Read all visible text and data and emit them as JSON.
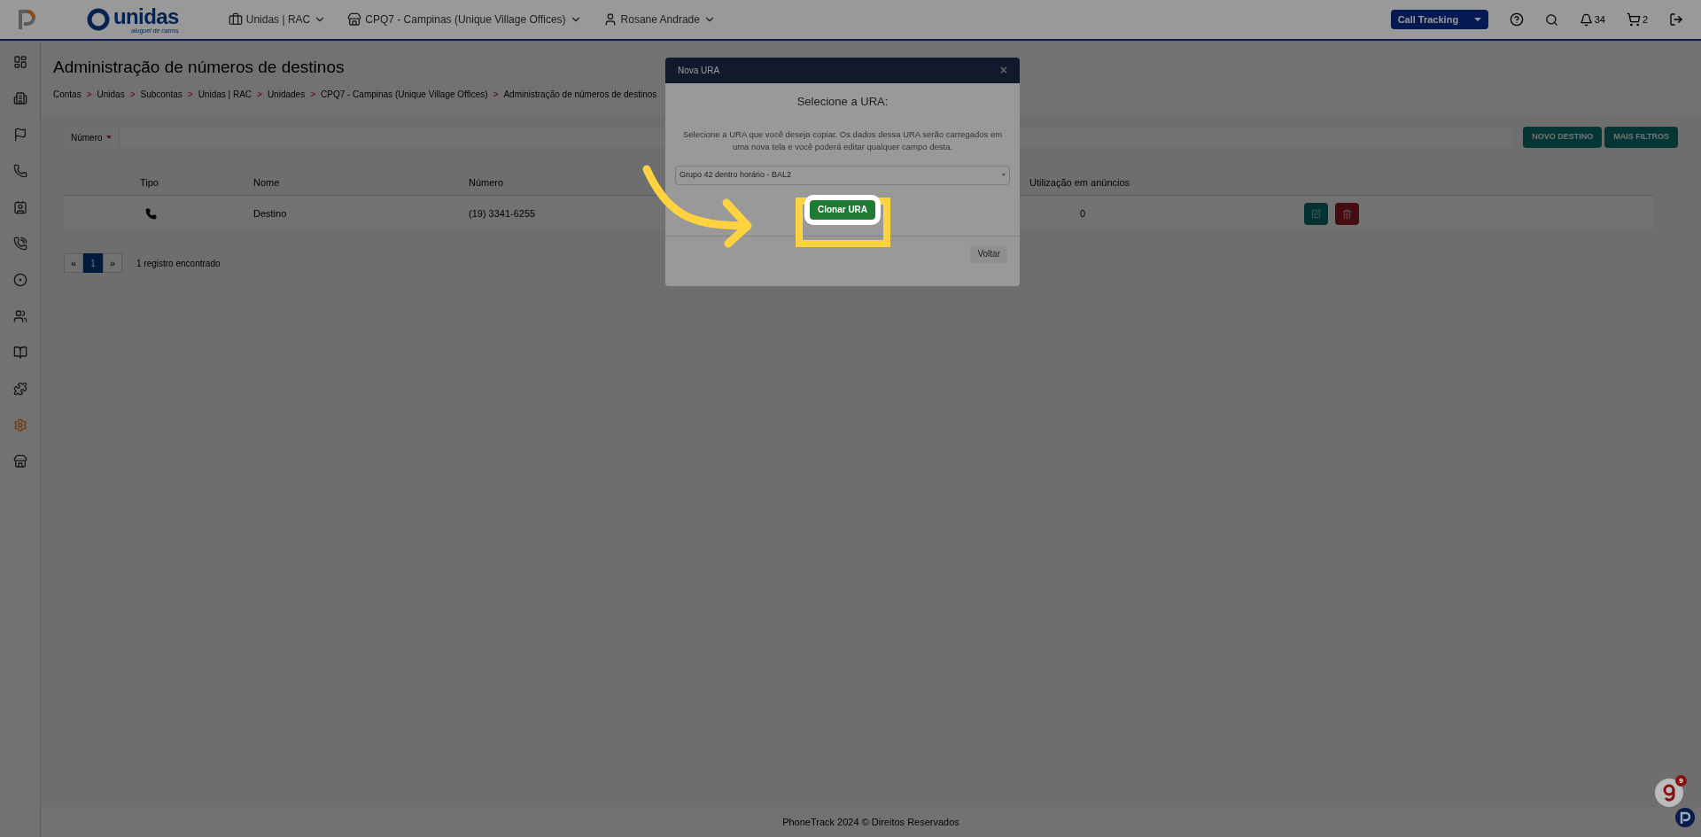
{
  "topbar": {
    "brand": "unidas",
    "tagline": "aluguel de carros",
    "account": "Unidas | RAC",
    "unit": "CPQ7 - Campinas (Unique Village Offices)",
    "user": "Rosane Andrade",
    "product": "Call Tracking",
    "notifications": "34",
    "cart": "2"
  },
  "sidebar": {
    "items": [
      {
        "selected": false
      },
      {
        "selected": false
      },
      {
        "selected": false
      },
      {
        "selected": false
      },
      {
        "selected": false
      },
      {
        "selected": false
      },
      {
        "selected": false
      },
      {
        "selected": false
      },
      {
        "selected": false
      },
      {
        "selected": false
      },
      {
        "selected": true
      },
      {
        "selected": false
      }
    ]
  },
  "page": {
    "title": "Administração de números de destinos",
    "separator": ">",
    "breadcrumb": [
      "Contas",
      "Unidas",
      "Subcontas",
      "Unidas | RAC",
      "Unidades",
      "CPQ7 - Campinas (Unique Village Offices)",
      "Administração de números de destinos"
    ],
    "filter": {
      "label": "Número"
    },
    "buttons": [
      "NOVO DESTINO",
      "MAIS FILTROS"
    ]
  },
  "table": {
    "columns": [
      "Tipo",
      "Nome",
      "Número",
      "Utilização em anúncios"
    ],
    "rows": [
      {
        "nome": "Destino",
        "numero": "(19) 3341-6255",
        "utilizacao": "0"
      }
    ]
  },
  "pagination": {
    "prev": "«",
    "pages": [
      {
        "label": "1",
        "selected": true
      }
    ],
    "next": "»",
    "summary": "1 registro encontrado"
  },
  "modal": {
    "title": "Nova URA",
    "close": "×",
    "heading": "Selecione a URA:",
    "text": "Selecione a URA que você deseja copiar. Os dados dessa URA serão carregados em uma nova tela e você poderá editar qualquer campo desta.",
    "select": "Grupo 42 dentro horário - BAL2",
    "primary": "Clonar URA",
    "secondary": "Voltar"
  },
  "footer": "PhoneTrack 2024 © Direitos Reservados",
  "widget": {
    "badge": "9"
  }
}
